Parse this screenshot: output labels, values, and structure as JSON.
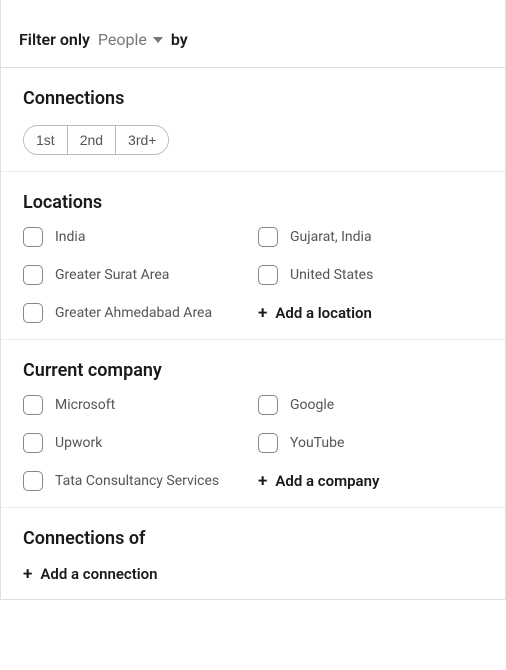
{
  "header": {
    "prefix": "Filter only",
    "dropdown_value": "People",
    "suffix": "by"
  },
  "connections": {
    "title": "Connections",
    "degrees": [
      "1st",
      "2nd",
      "3rd+"
    ]
  },
  "locations": {
    "title": "Locations",
    "options": [
      "India",
      "Gujarat, India",
      "Greater Surat Area",
      "United States",
      "Greater Ahmedabad Area"
    ],
    "add_label": "Add a location"
  },
  "company": {
    "title": "Current company",
    "options": [
      "Microsoft",
      "Google",
      "Upwork",
      "YouTube",
      "Tata Consultancy Services"
    ],
    "add_label": "Add a company"
  },
  "connections_of": {
    "title": "Connections of",
    "add_label": "Add a connection"
  }
}
